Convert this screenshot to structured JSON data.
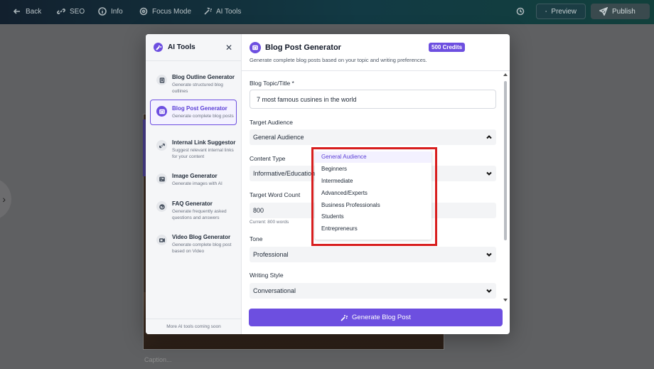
{
  "topbar": {
    "back": "Back",
    "seo": "SEO",
    "info": "Info",
    "focus": "Focus Mode",
    "ai_tools": "AI Tools",
    "preview": "Preview",
    "publish": "Publish"
  },
  "editor": {
    "caption_placeholder": "Caption..."
  },
  "sidebar": {
    "title": "AI Tools",
    "footer": "More AI tools coming soon",
    "tools": [
      {
        "name": "Blog Outline Generator",
        "desc": "Generate structured blog outlines",
        "icon": "document-icon"
      },
      {
        "name": "Blog Post Generator",
        "desc": "Generate complete blog posts",
        "icon": "post-icon",
        "active": true
      },
      {
        "name": "Internal Link Suggestor",
        "desc": "Suggest relevant internal links for your content",
        "icon": "link-icon"
      },
      {
        "name": "Image Generator",
        "desc": "Generate images with AI",
        "icon": "image-icon"
      },
      {
        "name": "FAQ Generator",
        "desc": "Generate frequently asked questions and answers",
        "icon": "question-icon"
      },
      {
        "name": "Video Blog Generator",
        "desc": "Generate complete blog post based on Video",
        "icon": "video-icon"
      }
    ]
  },
  "main": {
    "title": "Blog Post Generator",
    "credits": "500 Credits",
    "subtitle": "Generate complete blog posts based on your topic and writing preferences.",
    "topic_label": "Blog Topic/Title *",
    "topic_value": "7 most famous cusines in the world",
    "audience_label": "Target Audience",
    "audience_value": "General Audience",
    "content_type_label": "Content Type",
    "content_type_value": "Informative/Educational",
    "word_count_label": "Target Word Count",
    "word_count_value": "800",
    "word_count_hint": "Current: 800 words",
    "tone_label": "Tone",
    "tone_value": "Professional",
    "style_label": "Writing Style",
    "style_value": "Conversational",
    "generate_button": "Generate Blog Post"
  },
  "audience_dropdown": {
    "options": [
      "General Audience",
      "Beginners",
      "Intermediate",
      "Advanced/Experts",
      "Business Professionals",
      "Students",
      "Entrepreneurs"
    ],
    "selected": "General Audience"
  },
  "colors": {
    "accent": "#6d4fe0",
    "highlight": "#d81e1e"
  }
}
